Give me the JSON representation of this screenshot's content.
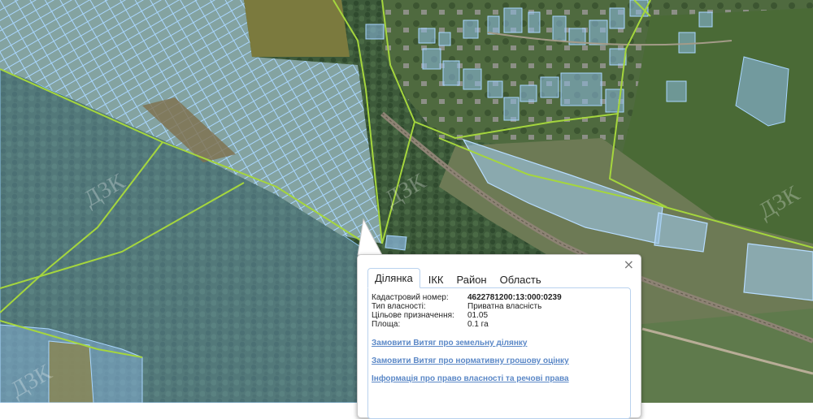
{
  "map": {
    "watermark_text": "ДЗК",
    "colors": {
      "forest": "#3e5b3b",
      "field": "#7e8a52",
      "parcel_fill": "#8dbbe4",
      "parcel_stroke": "#9ed0ff",
      "boundary": "#a3d43f",
      "road": "#9b8f74"
    }
  },
  "popup": {
    "close_label": "×",
    "tabs": [
      {
        "label": "Ділянка",
        "active": true
      },
      {
        "label": "ІКК",
        "active": false
      },
      {
        "label": "Район",
        "active": false
      },
      {
        "label": "Область",
        "active": false
      }
    ],
    "fields": [
      {
        "label": "Кадастровий номер:",
        "value": "4622781200:13:000:0239"
      },
      {
        "label": "Тип власності:",
        "value": "Приватна власність"
      },
      {
        "label": "Цільове призначення:",
        "value": "01.05"
      },
      {
        "label": "Площа:",
        "value": "0.1 га"
      }
    ],
    "links": [
      "Замовити Витяг про земельну ділянку",
      "Замовити Витяг про нормативну грошову оцінку",
      "Інформація про право власності та речові права"
    ]
  }
}
